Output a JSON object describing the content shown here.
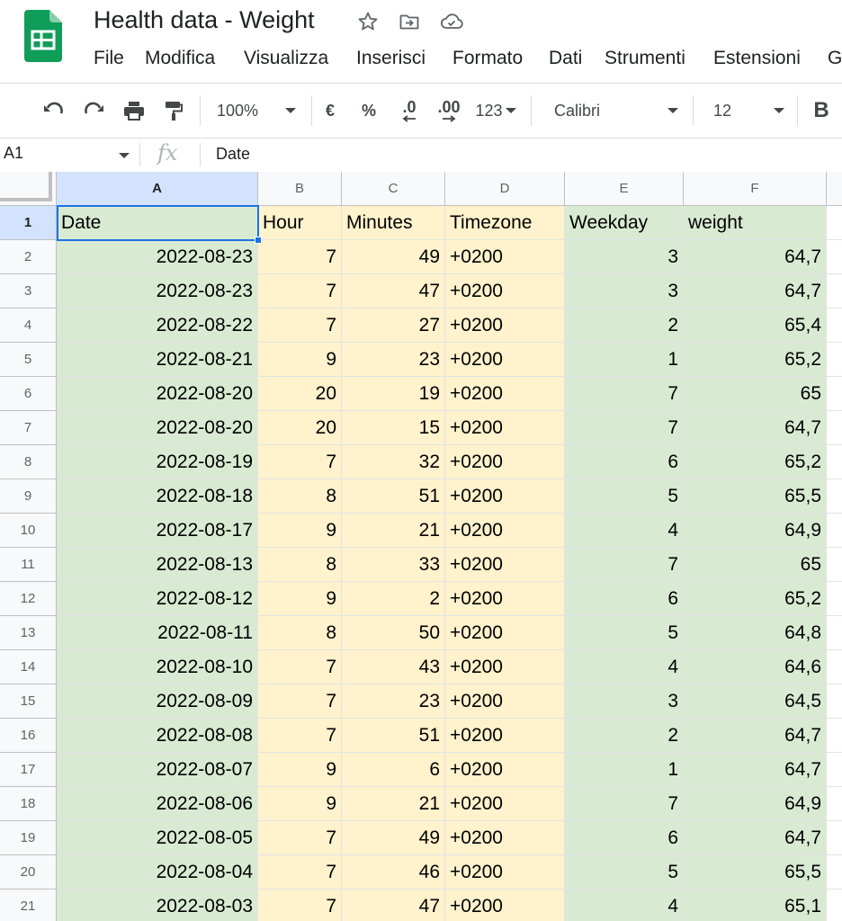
{
  "app": {
    "title": "Health data - Weight",
    "menu": [
      "File",
      "Modifica",
      "Visualizza",
      "Inserisci",
      "Formato",
      "Dati",
      "Strumenti",
      "Estensioni",
      "G"
    ]
  },
  "toolbar": {
    "zoom": "100%",
    "currency": "€",
    "percent": "%",
    "decrease_decimals": ".0",
    "increase_decimals": ".00",
    "number_format": "123",
    "font": "Calibri",
    "font_size": "12",
    "bold": "B"
  },
  "formula_bar": {
    "cell_ref": "A1",
    "fx": "fx",
    "value": "Date"
  },
  "colors": {
    "green_fill": "#d9ead3",
    "yellow_fill": "#fff2cc",
    "selection": "#1a73e8",
    "sheets_green": "#0f9d58"
  },
  "grid": {
    "column_letters": [
      "A",
      "B",
      "C",
      "D",
      "E",
      "F"
    ],
    "header_row": [
      "Date",
      "Hour",
      "Minutes",
      "Timezone",
      "Weekday",
      "weight"
    ],
    "rows": [
      {
        "num": "2",
        "cells": [
          "2022-08-23",
          "7",
          "49",
          "+0200",
          "3",
          "64,7"
        ]
      },
      {
        "num": "3",
        "cells": [
          "2022-08-23",
          "7",
          "47",
          "+0200",
          "3",
          "64,7"
        ]
      },
      {
        "num": "4",
        "cells": [
          "2022-08-22",
          "7",
          "27",
          "+0200",
          "2",
          "65,4"
        ]
      },
      {
        "num": "5",
        "cells": [
          "2022-08-21",
          "9",
          "23",
          "+0200",
          "1",
          "65,2"
        ]
      },
      {
        "num": "6",
        "cells": [
          "2022-08-20",
          "20",
          "19",
          "+0200",
          "7",
          "65"
        ]
      },
      {
        "num": "7",
        "cells": [
          "2022-08-20",
          "20",
          "15",
          "+0200",
          "7",
          "64,7"
        ]
      },
      {
        "num": "8",
        "cells": [
          "2022-08-19",
          "7",
          "32",
          "+0200",
          "6",
          "65,2"
        ]
      },
      {
        "num": "9",
        "cells": [
          "2022-08-18",
          "8",
          "51",
          "+0200",
          "5",
          "65,5"
        ]
      },
      {
        "num": "10",
        "cells": [
          "2022-08-17",
          "9",
          "21",
          "+0200",
          "4",
          "64,9"
        ]
      },
      {
        "num": "11",
        "cells": [
          "2022-08-13",
          "8",
          "33",
          "+0200",
          "7",
          "65"
        ]
      },
      {
        "num": "12",
        "cells": [
          "2022-08-12",
          "9",
          "2",
          "+0200",
          "6",
          "65,2"
        ]
      },
      {
        "num": "13",
        "cells": [
          "2022-08-11",
          "8",
          "50",
          "+0200",
          "5",
          "64,8"
        ]
      },
      {
        "num": "14",
        "cells": [
          "2022-08-10",
          "7",
          "43",
          "+0200",
          "4",
          "64,6"
        ]
      },
      {
        "num": "15",
        "cells": [
          "2022-08-09",
          "7",
          "23",
          "+0200",
          "3",
          "64,5"
        ]
      },
      {
        "num": "16",
        "cells": [
          "2022-08-08",
          "7",
          "51",
          "+0200",
          "2",
          "64,7"
        ]
      },
      {
        "num": "17",
        "cells": [
          "2022-08-07",
          "9",
          "6",
          "+0200",
          "1",
          "64,7"
        ]
      },
      {
        "num": "18",
        "cells": [
          "2022-08-06",
          "9",
          "21",
          "+0200",
          "7",
          "64,9"
        ]
      },
      {
        "num": "19",
        "cells": [
          "2022-08-05",
          "7",
          "49",
          "+0200",
          "6",
          "64,7"
        ]
      },
      {
        "num": "20",
        "cells": [
          "2022-08-04",
          "7",
          "46",
          "+0200",
          "5",
          "65,5"
        ]
      },
      {
        "num": "21",
        "cells": [
          "2022-08-03",
          "7",
          "47",
          "+0200",
          "4",
          "65,1"
        ]
      }
    ]
  }
}
